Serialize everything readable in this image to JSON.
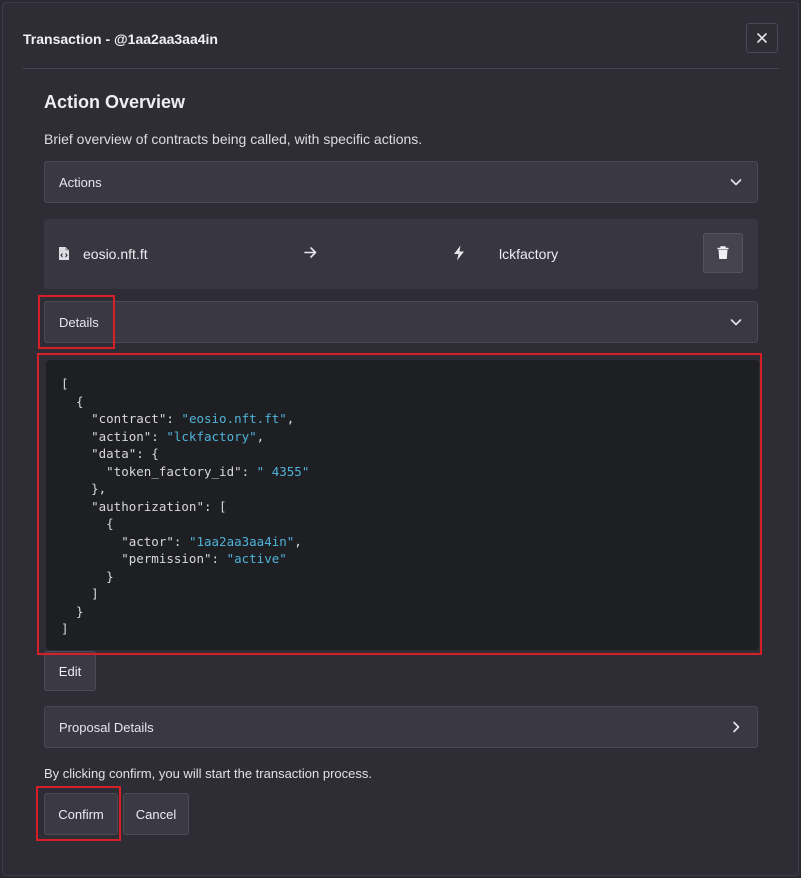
{
  "header": {
    "title": "Transaction - @1aa2aa3aa4in"
  },
  "overview": {
    "title": "Action Overview",
    "description": "Brief overview of contracts being called, with specific actions."
  },
  "actions_accordion": {
    "label": "Actions",
    "icon": "chevron-down-icon"
  },
  "action": {
    "contract": "eosio.nft.ft",
    "name": "lckfactory"
  },
  "details_accordion": {
    "label": "Details",
    "icon": "chevron-down-icon"
  },
  "code": {
    "l1": "[",
    "l2": "  {",
    "l3_key": "    \"contract\": ",
    "l3_val": "\"eosio.nft.ft\"",
    "l3_end": ",",
    "l4_key": "    \"action\": ",
    "l4_val": "\"lckfactory\"",
    "l4_end": ",",
    "l5": "    \"data\": {",
    "l6_key": "      \"token_factory_id\": ",
    "l6_val": "\" 4355\"",
    "l7": "    },",
    "l8": "    \"authorization\": [",
    "l9": "      {",
    "l10_key": "        \"actor\": ",
    "l10_val": "\"1aa2aa3aa4in\"",
    "l10_end": ",",
    "l11_key": "        \"permission\": ",
    "l11_val": "\"active\"",
    "l12": "      }",
    "l13": "    ]",
    "l14": "  }",
    "l15": "]"
  },
  "edit_button": "Edit",
  "proposal_accordion": {
    "label": "Proposal Details",
    "icon": "chevron-right-icon"
  },
  "notice": "By clicking confirm, you will start the transaction process.",
  "confirm_button": "Confirm",
  "cancel_button": "Cancel",
  "colors": {
    "highlight": "#d62028",
    "json_string": "#4fb3d9"
  }
}
